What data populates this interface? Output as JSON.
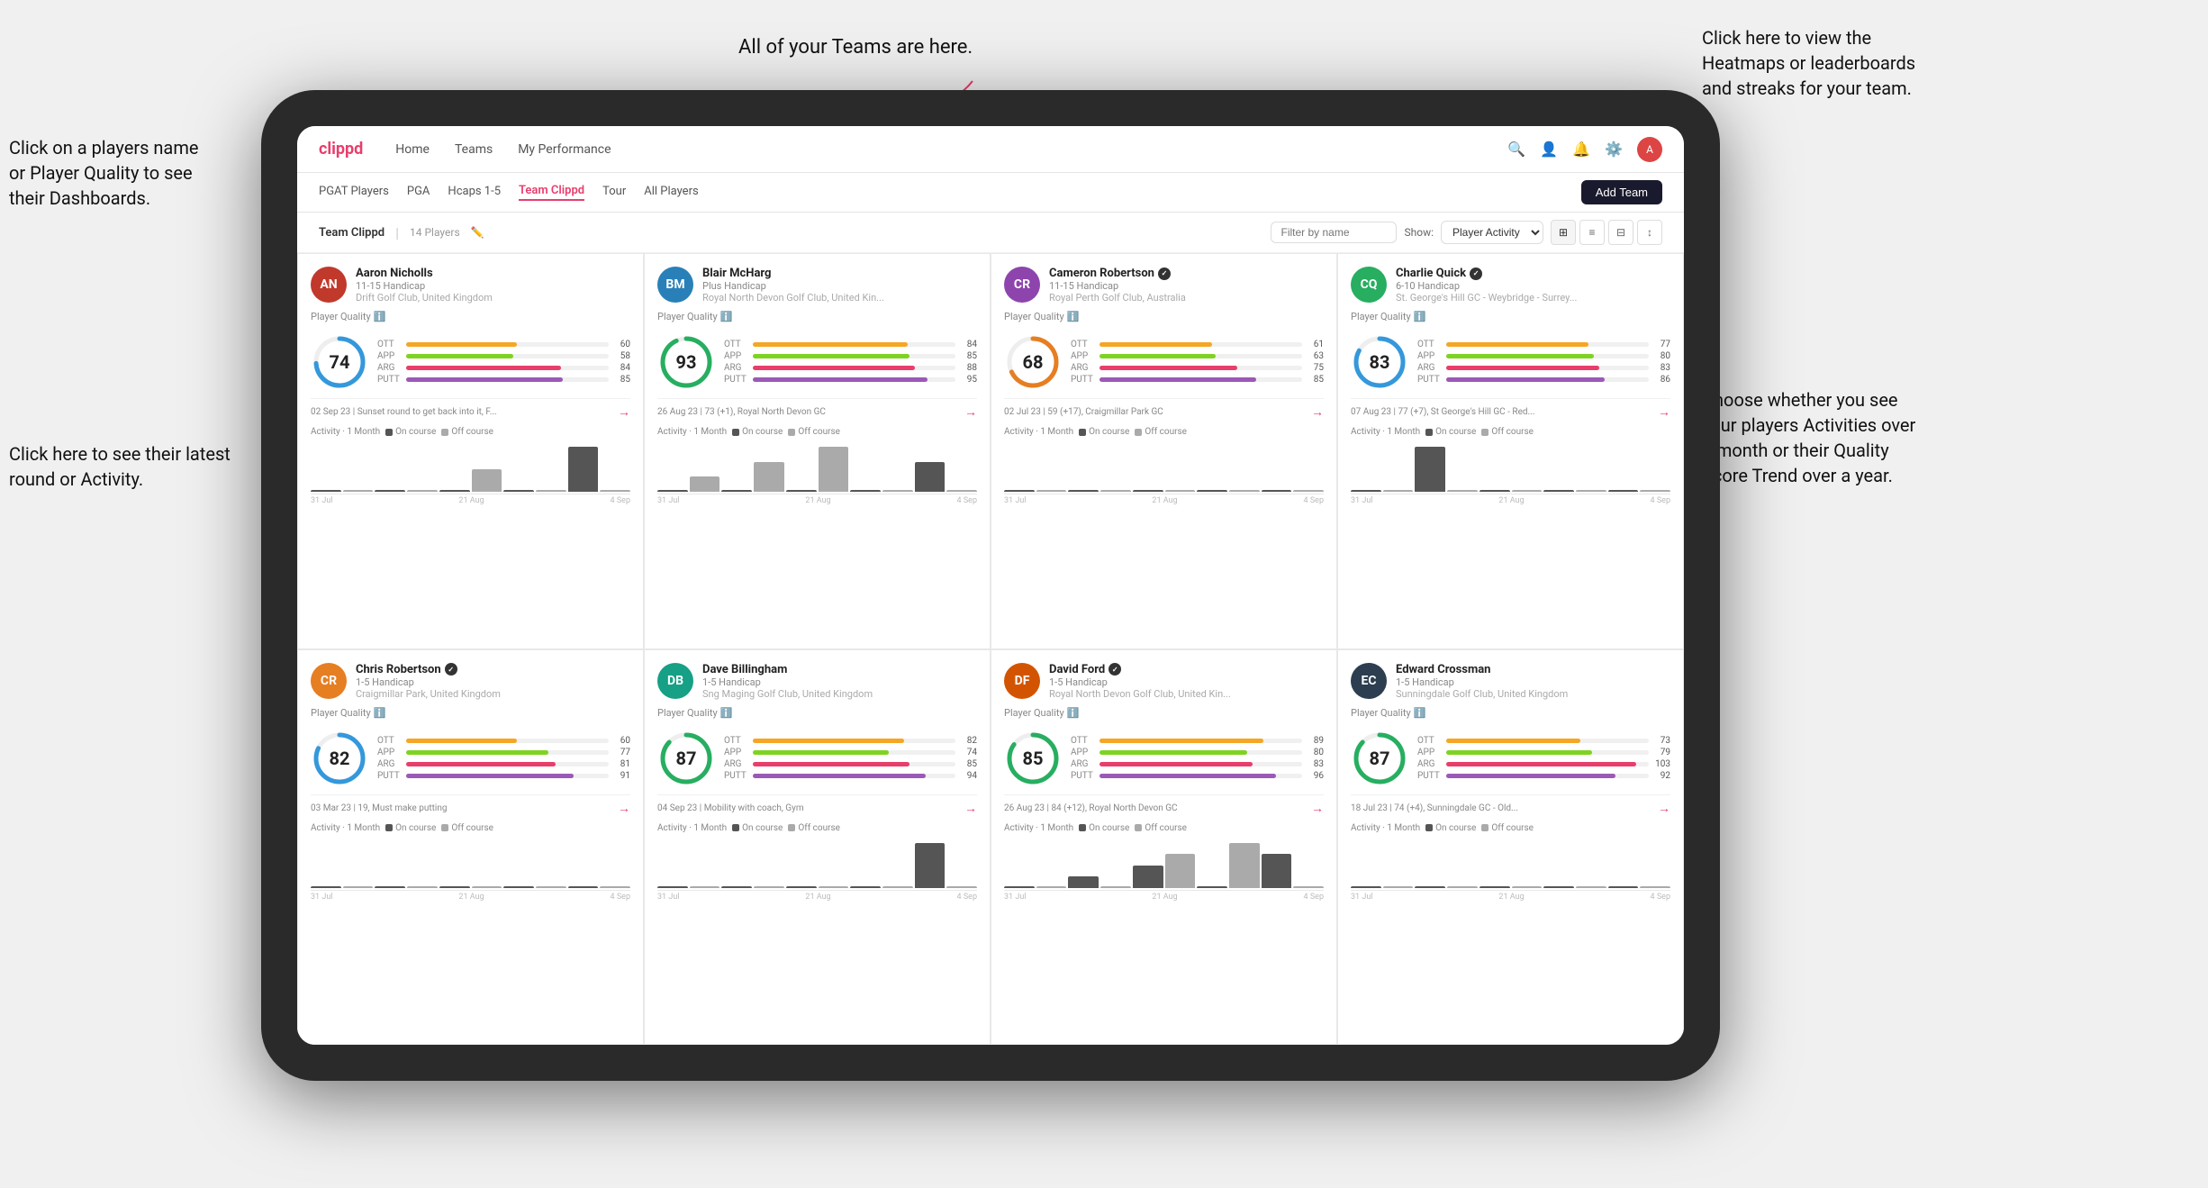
{
  "annotations": {
    "teams_hint": "All of your Teams are here.",
    "heatmaps_hint": "Click here to view the\nHeatmaps or leaderboards\nand streaks for your team.",
    "player_name_hint": "Click on a players name\nor Player Quality to see\ntheir Dashboards.",
    "round_hint": "Click here to see their latest\nround or Activity.",
    "activity_hint": "Choose whether you see\nyour players Activities over\na month or their Quality\nScore Trend over a year."
  },
  "navbar": {
    "logo": "clippd",
    "items": [
      "Home",
      "Teams",
      "My Performance"
    ],
    "icons": [
      "search",
      "person",
      "bell",
      "settings",
      "avatar"
    ]
  },
  "subnav": {
    "items": [
      "PGAT Players",
      "PGA",
      "Hcaps 1-5",
      "Team Clippd",
      "Tour",
      "All Players"
    ],
    "active": "Team Clippd",
    "add_btn": "Add Team"
  },
  "teambar": {
    "title": "Team Clippd",
    "count": "14 Players",
    "filter_placeholder": "Filter by name",
    "show_label": "Show:",
    "show_options": [
      "Player Activity"
    ],
    "show_selected": "Player Activity"
  },
  "players": [
    {
      "name": "Aaron Nicholls",
      "handicap": "11-15 Handicap",
      "club": "Drift Golf Club, United Kingdom",
      "quality": 74,
      "badge": false,
      "stats": [
        {
          "label": "OTT",
          "value": 60,
          "color": "#f5a623"
        },
        {
          "label": "APP",
          "value": 58,
          "color": "#7ed321"
        },
        {
          "label": "ARG",
          "value": 84,
          "color": "#e83e6c"
        },
        {
          "label": "PUTT",
          "value": 85,
          "color": "#9b59b6"
        }
      ],
      "latest_round": "02 Sep 23 | Sunset round to get back into it, F...",
      "activity_bars": [
        0,
        0,
        0,
        0,
        0,
        1,
        0,
        0,
        2,
        0
      ],
      "chart_dates": [
        "31 Jul",
        "21 Aug",
        "4 Sep"
      ]
    },
    {
      "name": "Blair McHarg",
      "handicap": "Plus Handicap",
      "club": "Royal North Devon Golf Club, United Kin...",
      "quality": 93,
      "badge": false,
      "stats": [
        {
          "label": "OTT",
          "value": 84,
          "color": "#f5a623"
        },
        {
          "label": "APP",
          "value": 85,
          "color": "#7ed321"
        },
        {
          "label": "ARG",
          "value": 88,
          "color": "#e83e6c"
        },
        {
          "label": "PUTT",
          "value": 95,
          "color": "#9b59b6"
        }
      ],
      "latest_round": "26 Aug 23 | 73 (+1), Royal North Devon GC",
      "activity_bars": [
        0,
        1,
        0,
        2,
        0,
        3,
        0,
        0,
        2,
        0
      ],
      "chart_dates": [
        "31 Jul",
        "21 Aug",
        "4 Sep"
      ]
    },
    {
      "name": "Cameron Robertson",
      "handicap": "11-15 Handicap",
      "club": "Royal Perth Golf Club, Australia",
      "quality": 68,
      "badge": true,
      "stats": [
        {
          "label": "OTT",
          "value": 61,
          "color": "#f5a623"
        },
        {
          "label": "APP",
          "value": 63,
          "color": "#7ed321"
        },
        {
          "label": "ARG",
          "value": 75,
          "color": "#e83e6c"
        },
        {
          "label": "PUTT",
          "value": 85,
          "color": "#9b59b6"
        }
      ],
      "latest_round": "02 Jul 23 | 59 (+17), Craigmillar Park GC",
      "activity_bars": [
        0,
        0,
        0,
        0,
        0,
        0,
        0,
        0,
        0,
        0
      ],
      "chart_dates": [
        "31 Jul",
        "21 Aug",
        "4 Sep"
      ]
    },
    {
      "name": "Charlie Quick",
      "handicap": "6-10 Handicap",
      "club": "St. George's Hill GC - Weybridge - Surrey...",
      "quality": 83,
      "badge": true,
      "stats": [
        {
          "label": "OTT",
          "value": 77,
          "color": "#f5a623"
        },
        {
          "label": "APP",
          "value": 80,
          "color": "#7ed321"
        },
        {
          "label": "ARG",
          "value": 83,
          "color": "#e83e6c"
        },
        {
          "label": "PUTT",
          "value": 86,
          "color": "#9b59b6"
        }
      ],
      "latest_round": "07 Aug 23 | 77 (+7), St George's Hill GC - Red...",
      "activity_bars": [
        0,
        0,
        1,
        0,
        0,
        0,
        0,
        0,
        0,
        0
      ],
      "chart_dates": [
        "31 Jul",
        "21 Aug",
        "4 Sep"
      ]
    },
    {
      "name": "Chris Robertson",
      "handicap": "1-5 Handicap",
      "club": "Craigmillar Park, United Kingdom",
      "quality": 82,
      "badge": true,
      "stats": [
        {
          "label": "OTT",
          "value": 60,
          "color": "#f5a623"
        },
        {
          "label": "APP",
          "value": 77,
          "color": "#7ed321"
        },
        {
          "label": "ARG",
          "value": 81,
          "color": "#e83e6c"
        },
        {
          "label": "PUTT",
          "value": 91,
          "color": "#9b59b6"
        }
      ],
      "latest_round": "03 Mar 23 | 19, Must make putting",
      "activity_bars": [
        0,
        0,
        0,
        0,
        0,
        0,
        0,
        0,
        0,
        0
      ],
      "chart_dates": [
        "31 Jul",
        "21 Aug",
        "4 Sep"
      ]
    },
    {
      "name": "Dave Billingham",
      "handicap": "1-5 Handicap",
      "club": "Sng Maging Golf Club, United Kingdom",
      "quality": 87,
      "badge": false,
      "stats": [
        {
          "label": "OTT",
          "value": 82,
          "color": "#f5a623"
        },
        {
          "label": "APP",
          "value": 74,
          "color": "#7ed321"
        },
        {
          "label": "ARG",
          "value": 85,
          "color": "#e83e6c"
        },
        {
          "label": "PUTT",
          "value": 94,
          "color": "#9b59b6"
        }
      ],
      "latest_round": "04 Sep 23 | Mobility with coach, Gym",
      "activity_bars": [
        0,
        0,
        0,
        0,
        0,
        0,
        0,
        0,
        1,
        0
      ],
      "chart_dates": [
        "31 Jul",
        "21 Aug",
        "4 Sep"
      ]
    },
    {
      "name": "David Ford",
      "handicap": "1-5 Handicap",
      "club": "Royal North Devon Golf Club, United Kin...",
      "quality": 85,
      "badge": true,
      "stats": [
        {
          "label": "OTT",
          "value": 89,
          "color": "#f5a623"
        },
        {
          "label": "APP",
          "value": 80,
          "color": "#7ed321"
        },
        {
          "label": "ARG",
          "value": 83,
          "color": "#e83e6c"
        },
        {
          "label": "PUTT",
          "value": 96,
          "color": "#9b59b6"
        }
      ],
      "latest_round": "26 Aug 23 | 84 (+12), Royal North Devon GC",
      "activity_bars": [
        0,
        0,
        1,
        0,
        2,
        3,
        0,
        4,
        3,
        0
      ],
      "chart_dates": [
        "31 Jul",
        "21 Aug",
        "4 Sep"
      ]
    },
    {
      "name": "Edward Crossman",
      "handicap": "1-5 Handicap",
      "club": "Sunningdale Golf Club, United Kingdom",
      "quality": 87,
      "badge": false,
      "stats": [
        {
          "label": "OTT",
          "value": 73,
          "color": "#f5a623"
        },
        {
          "label": "APP",
          "value": 79,
          "color": "#7ed321"
        },
        {
          "label": "ARG",
          "value": 103,
          "color": "#e83e6c"
        },
        {
          "label": "PUTT",
          "value": 92,
          "color": "#9b59b6"
        }
      ],
      "latest_round": "18 Jul 23 | 74 (+4), Sunningdale GC - Old...",
      "activity_bars": [
        0,
        0,
        0,
        0,
        0,
        0,
        0,
        0,
        0,
        0
      ],
      "chart_dates": [
        "31 Jul",
        "21 Aug",
        "4 Sep"
      ]
    }
  ],
  "activity_legend": {
    "label": "Activity · 1 Month",
    "on_course": "On course",
    "off_course": "Off course",
    "on_color": "#333",
    "off_color": "#aaa"
  }
}
